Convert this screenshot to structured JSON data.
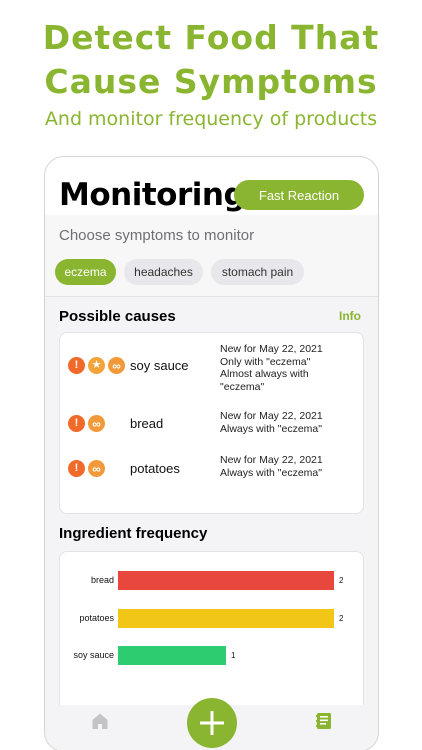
{
  "promo": {
    "title_line1": "Detect Food That",
    "title_line2": "Cause Symptoms",
    "subtitle": "And monitor frequency of products"
  },
  "header": {
    "title": "Monitoring",
    "fast_reaction_label": "Fast Reaction"
  },
  "symptoms": {
    "prompt": "Choose symptoms to monitor",
    "chips": [
      {
        "label": "eczema",
        "selected": true
      },
      {
        "label": "headaches",
        "selected": false
      },
      {
        "label": "stomach pain",
        "selected": false
      }
    ]
  },
  "causes": {
    "heading": "Possible causes",
    "info_label": "Info",
    "items": [
      {
        "icons": [
          "exclamation-icon",
          "star-icon",
          "infinity-icon"
        ],
        "name": "soy sauce",
        "note": "New for May 22, 2021\nOnly with \"eczema\"\nAlmost always with\n\"eczema\""
      },
      {
        "icons": [
          "exclamation-icon",
          "infinity-icon"
        ],
        "name": "bread",
        "note": "New for May 22, 2021\nAlways with \"eczema\""
      },
      {
        "icons": [
          "exclamation-icon",
          "infinity-icon"
        ],
        "name": "potatoes",
        "note": "New for May 22, 2021\nAlways with \"eczema\""
      }
    ]
  },
  "frequency": {
    "heading": "Ingredient frequency"
  },
  "chart_data": {
    "type": "bar",
    "orientation": "horizontal",
    "categories": [
      "bread",
      "potatoes",
      "soy sauce"
    ],
    "values": [
      2,
      2,
      1
    ],
    "colors": [
      "#e8473e",
      "#f2c617",
      "#2ecc71"
    ],
    "xlim": [
      0,
      2
    ],
    "title": "",
    "xlabel": "",
    "ylabel": ""
  },
  "tabbar": {
    "home_icon": "home-icon",
    "add_icon": "plus-icon",
    "log_icon": "journal-icon"
  },
  "colors": {
    "accent": "#8ab530",
    "warning": "#f06a2a"
  }
}
